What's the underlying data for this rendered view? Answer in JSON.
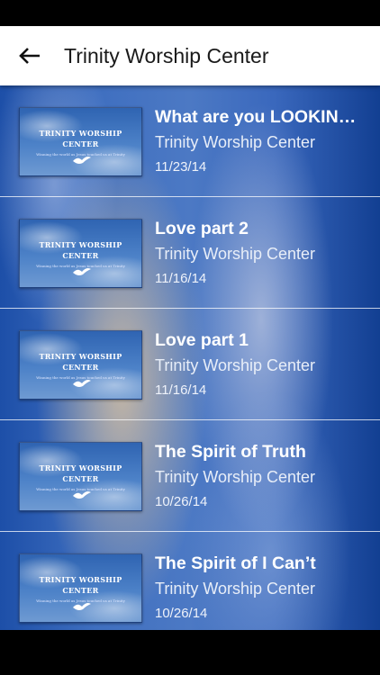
{
  "header": {
    "title": "Trinity Worship Center",
    "back_icon": "arrow-left-icon"
  },
  "thumbnail": {
    "title": "TRINITY WORSHIP\nCENTER",
    "tagline": "Winning the world as Jesus touched us at Trinity"
  },
  "colors": {
    "app_bar": "#ffffff",
    "title_text": "#1a1a1a",
    "background_blue": "#3f6fc0",
    "row_text": "#ffffff",
    "divider": "#ffffff"
  },
  "sermons": [
    {
      "title": "What are you LOOKING FOR?",
      "author": "Trinity Worship Center",
      "date": "11/23/14"
    },
    {
      "title": "Love part 2",
      "author": "Trinity Worship Center",
      "date": "11/16/14"
    },
    {
      "title": "Love part 1",
      "author": "Trinity Worship Center",
      "date": "11/16/14"
    },
    {
      "title": "The Spirit of Truth",
      "author": "Trinity Worship Center",
      "date": "10/26/14"
    },
    {
      "title": "The Spirit of I Can’t",
      "author": "Trinity Worship Center",
      "date": "10/26/14"
    }
  ]
}
